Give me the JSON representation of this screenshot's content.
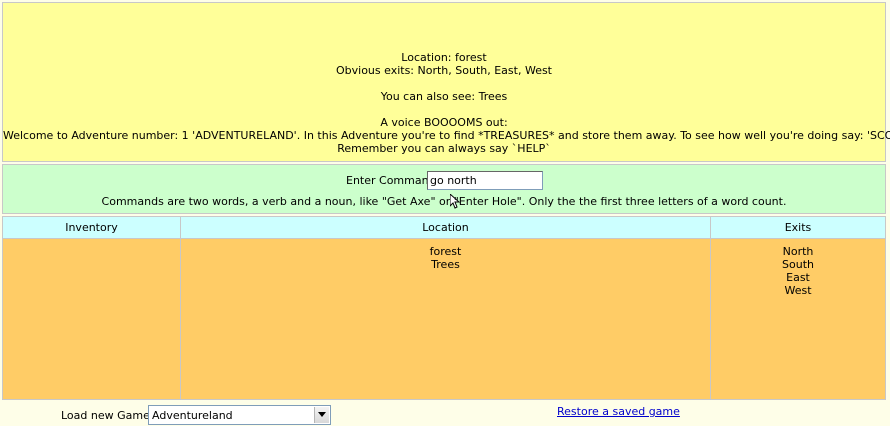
{
  "messages": {
    "location_line": "Location: forest",
    "exits_line": "Obvious exits: North, South, East, West",
    "see_line": "You can also see: Trees",
    "voice_line": "A voice BOOOOMS out:",
    "welcome_line": "Welcome to Adventure number: 1 'ADVENTURELAND'. In this Adventure you're to find *TREASURES* and store them away. To see how well you're doing say: 'SCORE'",
    "help_line": "Remember you can always say `HELP`"
  },
  "command": {
    "label": "Enter Command:",
    "value": "go north",
    "help_text": "Commands are two words, a verb and a noun, like \"Get Axe\" or \"Enter Hole\". Only the the first three letters of a word count."
  },
  "columns": {
    "inventory": {
      "header": "Inventory",
      "items": []
    },
    "location": {
      "header": "Location",
      "items": [
        "forest",
        "Trees"
      ]
    },
    "exits": {
      "header": "Exits",
      "items": [
        "North",
        "South",
        "East",
        "West"
      ]
    }
  },
  "bottom": {
    "load_label": "Load new Game:",
    "selected_game": "Adventureland",
    "restore_link": "Restore a saved game"
  },
  "colors": {
    "message_bg": "#ffff99",
    "command_bg": "#ccffcc",
    "header_bg": "#ccffff",
    "body_bg": "#ffcc66",
    "link": "#0000cc"
  }
}
